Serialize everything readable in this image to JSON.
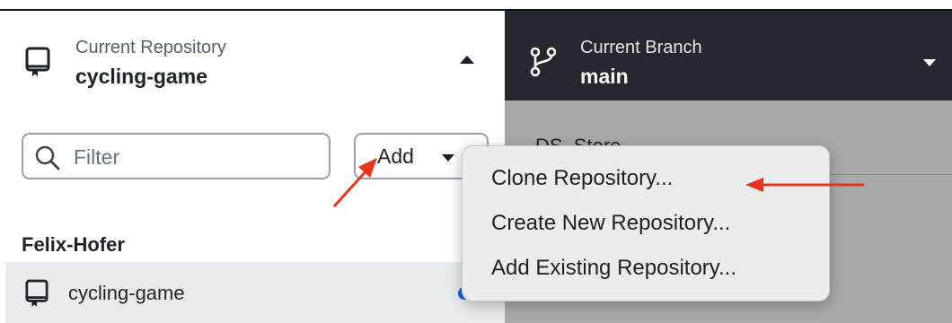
{
  "repository": {
    "label": "Current Repository",
    "name": "cycling-game",
    "icon": "repo-icon"
  },
  "branch": {
    "label": "Current Branch",
    "name": "main",
    "icon": "git-branch-icon"
  },
  "filter": {
    "placeholder": "Filter",
    "icon": "search-icon"
  },
  "add_button": {
    "label": "Add"
  },
  "repo_list": {
    "group": "Felix-Hofer",
    "items": [
      {
        "label": "cycling-game",
        "has_changes_indicator": true
      }
    ]
  },
  "changes_panel": {
    "file": "DS_Store"
  },
  "add_menu": {
    "items": [
      {
        "label": "Clone Repository..."
      },
      {
        "label": "Create New Repository..."
      },
      {
        "label": "Add Existing Repository..."
      }
    ]
  },
  "colors": {
    "branch_header_bg": "#24292e",
    "indicator_dot": "#1a66d9",
    "annotation_arrow": "#e8341c"
  }
}
